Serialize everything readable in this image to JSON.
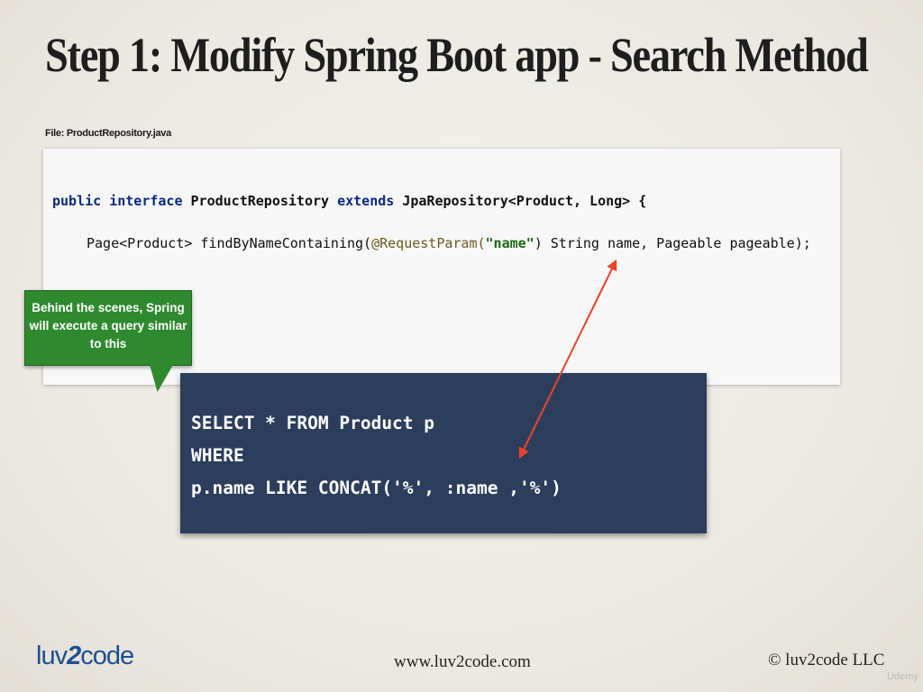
{
  "slide": {
    "title": "Step 1: Modify Spring Boot app - Search Method",
    "file_label": "File: ProductRepository.java"
  },
  "code": {
    "line1": {
      "kw1": "public",
      "kw2": "interface",
      "name": "ProductRepository",
      "kw3": "extends",
      "rest": "JpaRepository<Product, Long> {"
    },
    "line2": {
      "pre": "Page<Product> findByNameContaining(",
      "annotation": "@RequestParam(",
      "string": "\"name\"",
      "post": ") String name, Pageable pageable);"
    }
  },
  "callout": {
    "text_line1": "Behind the scenes, Spring",
    "text_line2": "will execute a query similar",
    "text_line3": "to this"
  },
  "sql": {
    "line1": "SELECT * FROM Product p",
    "line2": "WHERE",
    "line3": "p.name LIKE CONCAT('%', :name ,'%')"
  },
  "footer": {
    "logo_text_a": "luv",
    "logo_text_b": "2",
    "logo_text_c": "code",
    "website": "www.luv2code.com",
    "copyright": "© luv2code LLC",
    "watermark": "Udemy"
  },
  "colors": {
    "callout_bg": "#2f8a2f",
    "sql_bg": "#2c3e5c",
    "arrow": "#e8442a",
    "keyword": "#0a2a80",
    "string": "#1b6b14"
  }
}
